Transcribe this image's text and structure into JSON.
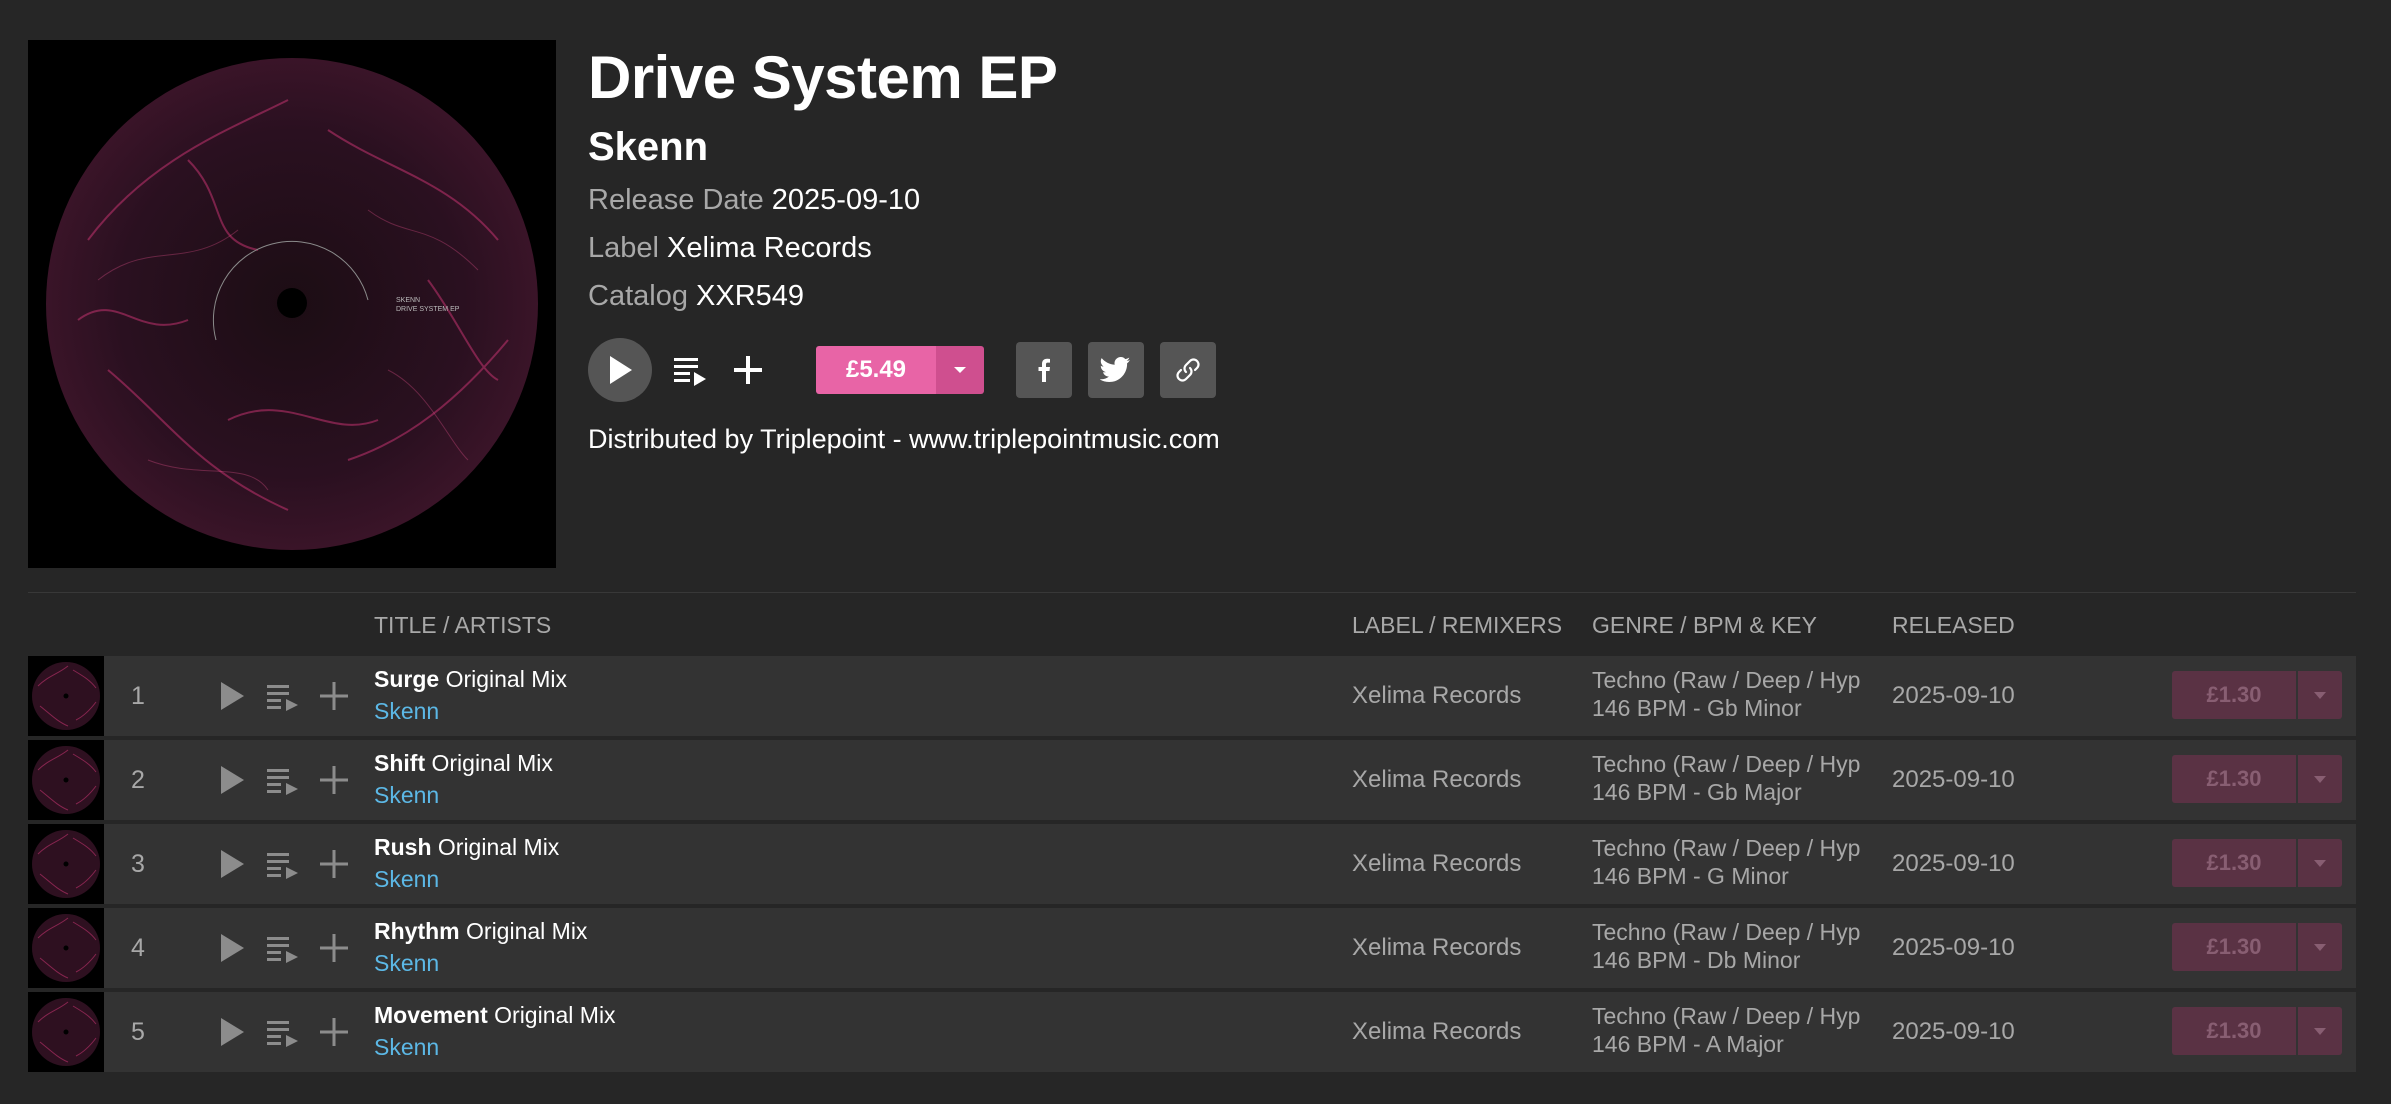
{
  "release": {
    "title": "Drive System EP",
    "artist": "Skenn",
    "release_date_label": "Release Date",
    "release_date": "2025-09-10",
    "label_label": "Label",
    "label": "Xelima Records",
    "catalog_label": "Catalog",
    "catalog": "XXR549",
    "price": "£5.49",
    "distributed": "Distributed by Triplepoint - www.triplepointmusic.com",
    "cover_text_line1": "SKENN",
    "cover_text_line2": "DRIVE SYSTEM EP"
  },
  "icons": {
    "play": "play-icon",
    "queue": "add-to-queue-icon",
    "add": "plus-icon",
    "dropdown": "chevron-down-icon",
    "facebook": "facebook-icon",
    "twitter": "twitter-icon",
    "link": "link-icon"
  },
  "colors": {
    "accent": "#e864a6",
    "accent_dark": "#cf4f8f",
    "artist_link": "#5cb8e6",
    "background": "#262626",
    "row_background": "#333333",
    "disabled_price": "#5a3244"
  },
  "table": {
    "headers": {
      "title": "TITLE / ARTISTS",
      "label": "LABEL / REMIXERS",
      "genre": "GENRE / BPM & KEY",
      "released": "RELEASED"
    },
    "tracks": [
      {
        "num": "1",
        "name": "Surge",
        "mix": "Original Mix",
        "artist": "Skenn",
        "label": "Xelima Records",
        "genre": "Techno (Raw / Deep / Hypnotic)",
        "bpm_key": "146 BPM - Gb Minor",
        "released": "2025-09-10",
        "price": "£1.30"
      },
      {
        "num": "2",
        "name": "Shift",
        "mix": "Original Mix",
        "artist": "Skenn",
        "label": "Xelima Records",
        "genre": "Techno (Raw / Deep / Hypnotic)",
        "bpm_key": "146 BPM - Gb Major",
        "released": "2025-09-10",
        "price": "£1.30"
      },
      {
        "num": "3",
        "name": "Rush",
        "mix": "Original Mix",
        "artist": "Skenn",
        "label": "Xelima Records",
        "genre": "Techno (Raw / Deep / Hypnotic)",
        "bpm_key": "146 BPM - G Minor",
        "released": "2025-09-10",
        "price": "£1.30"
      },
      {
        "num": "4",
        "name": "Rhythm",
        "mix": "Original Mix",
        "artist": "Skenn",
        "label": "Xelima Records",
        "genre": "Techno (Raw / Deep / Hypnotic)",
        "bpm_key": "146 BPM - Db Minor",
        "released": "2025-09-10",
        "price": "£1.30"
      },
      {
        "num": "5",
        "name": "Movement",
        "mix": "Original Mix",
        "artist": "Skenn",
        "label": "Xelima Records",
        "genre": "Techno (Raw / Deep / Hypnotic)",
        "bpm_key": "146 BPM - A Major",
        "released": "2025-09-10",
        "price": "£1.30"
      }
    ]
  }
}
